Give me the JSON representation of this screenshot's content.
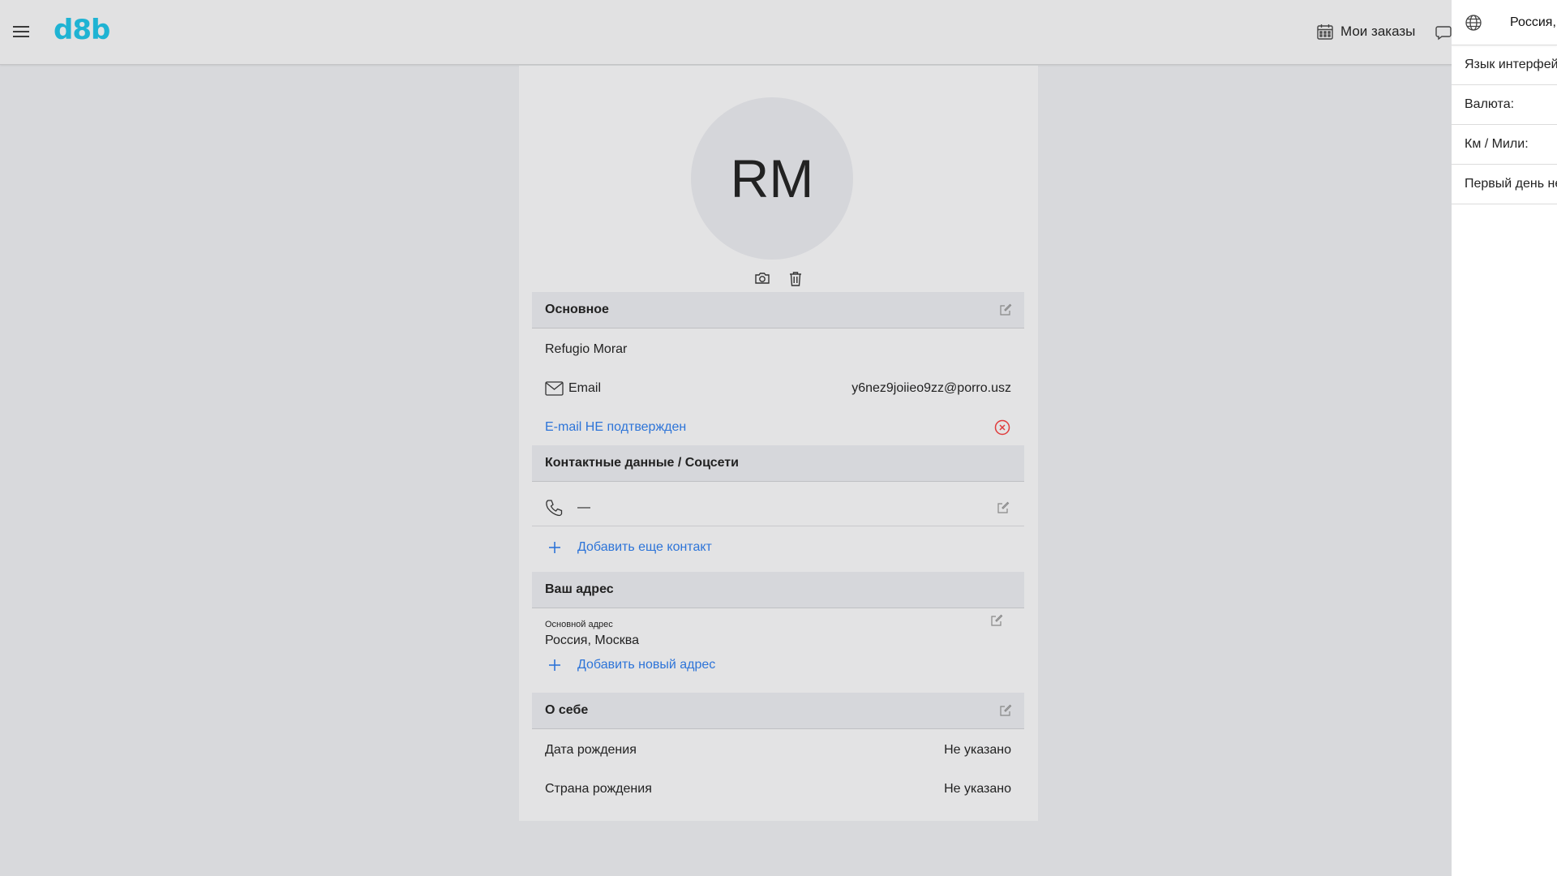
{
  "header": {
    "logo": "d8b",
    "orders_label": "Мои заказы"
  },
  "side_panel": {
    "region": "Россия,",
    "rows": [
      "Язык интерфейса",
      "Валюта:",
      "Км / Мили:",
      "Первый день недели"
    ]
  },
  "profile": {
    "initials": "RM",
    "sections": {
      "main": "Основное",
      "contacts": "Контактные данные / Соцсети",
      "address": "Ваш адрес",
      "about": "О себе"
    },
    "name": "Refugio Morar",
    "email_label": "Email",
    "email_value": "y6nez9joiieo9zz@porro.usz",
    "email_status": "E-mail НЕ подтвержден",
    "phone_value": "—",
    "add_contact": "Добавить еще контакт",
    "address_caption": "Основной адрес",
    "address_value": "Россия, Москва",
    "add_address": "Добавить новый адрес",
    "birth_date_label": "Дата рождения",
    "birth_date_value": "Не указано",
    "birth_country_label": "Страна рождения",
    "birth_country_value": "Не указано"
  },
  "colors": {
    "accent": "#1fb3d3",
    "link": "#2d74d8",
    "error": "#e03b3b"
  }
}
